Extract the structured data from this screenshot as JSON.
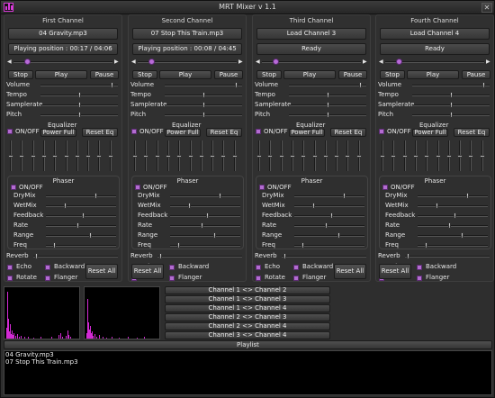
{
  "app": {
    "title": "MRT Mixer v 1.1"
  },
  "channels": [
    {
      "name": "First Channel",
      "file": "04 Gravity.mp3",
      "status": "Playing position : 00:17 / 04:06",
      "stop": "Stop",
      "play": "Play",
      "pause": "Pause",
      "controls": {
        "volume": "Volume",
        "tempo": "Tempo",
        "samplerate": "Samplerate",
        "pitch": "Pitch"
      },
      "equalizer": "Equalizer",
      "eq_onoff": "ON/OFF",
      "power_full": "Power Full",
      "reset_eq": "Reset Eq",
      "phaser": "Phaser",
      "ph_onoff": "ON/OFF",
      "phaser_params": {
        "drymix": "DryMix",
        "wetmix": "WetMix",
        "feedback": "Feedback",
        "rate": "Rate",
        "range": "Range",
        "freq": "Freq"
      },
      "reverb": "Reverb",
      "echo": "Echo",
      "backward": "Backward",
      "rotate": "Rotate",
      "flanger": "Flanger",
      "reset_all": "Reset All"
    },
    {
      "name": "Second Channel",
      "file": "07 Stop This Train.mp3",
      "status": "Playing position : 00:08 / 04:45",
      "stop": "Stop",
      "play": "Play",
      "pause": "Pause",
      "controls": {
        "volume": "Volume",
        "tempo": "Tempo",
        "samplerate": "Samplerate",
        "pitch": "Pitch"
      },
      "equalizer": "Equalizer",
      "eq_onoff": "ON/OFF",
      "power_full": "Power Full",
      "reset_eq": "Reset Eq",
      "phaser": "Phaser",
      "ph_onoff": "ON/OFF",
      "phaser_params": {
        "drymix": "DryMix",
        "wetmix": "WetMix",
        "feedback": "Feedback",
        "rate": "Rate",
        "range": "Range",
        "freq": "Freq"
      },
      "reverb": "Reverb",
      "echo": "Echo",
      "backward": "Backward",
      "rotate": "Rotate",
      "flanger": "Flanger",
      "reset_all": "Reset All"
    },
    {
      "name": "Third Channel",
      "file": "Load Channel 3",
      "status": "Ready",
      "stop": "Stop",
      "play": "Play",
      "pause": "Pause",
      "controls": {
        "volume": "Volume",
        "tempo": "Tempo",
        "samplerate": "Samplerate",
        "pitch": "Pitch"
      },
      "equalizer": "Equalizer",
      "eq_onoff": "ON/OFF",
      "power_full": "Power Full",
      "reset_eq": "Reset Eq",
      "phaser": "Phaser",
      "ph_onoff": "ON/OFF",
      "phaser_params": {
        "drymix": "DryMix",
        "wetmix": "WetMix",
        "feedback": "Feedback",
        "rate": "Rate",
        "range": "Range",
        "freq": "Freq"
      },
      "reverb": "Reverb",
      "echo": "Echo",
      "backward": "Backward",
      "rotate": "Rotate",
      "flanger": "Flanger",
      "reset_all": "Reset All"
    },
    {
      "name": "Fourth Channel",
      "file": "Load Channel 4",
      "status": "Ready",
      "stop": "Stop",
      "play": "Play",
      "pause": "Pause",
      "controls": {
        "volume": "Volume",
        "tempo": "Tempo",
        "samplerate": "Samplerate",
        "pitch": "Pitch"
      },
      "equalizer": "Equalizer",
      "eq_onoff": "ON/OFF",
      "power_full": "Power Full",
      "reset_eq": "Reset Eq",
      "phaser": "Phaser",
      "ph_onoff": "ON/OFF",
      "phaser_params": {
        "drymix": "DryMix",
        "wetmix": "WetMix",
        "feedback": "Feedback",
        "rate": "Rate",
        "range": "Range",
        "freq": "Freq"
      },
      "reverb": "Reverb",
      "echo": "Echo",
      "backward": "Backward",
      "rotate": "Rotate",
      "flanger": "Flanger",
      "reset_all": "Reset All"
    }
  ],
  "routing": [
    "Channel 1 <> Channel 2",
    "Channel 1 <> Channel 3",
    "Channel 1 <> Channel 4",
    "Channel 2 <> Channel 3",
    "Channel 2 <> Channel 4",
    "Channel 3 <> Channel 4"
  ],
  "playlist": {
    "title": "Playlist",
    "items": [
      "04 Gravity.mp3",
      "07 Stop This Train.mp3"
    ]
  },
  "colors": {
    "accent": "#b36cd1",
    "spectrum": "#d22ad4"
  }
}
